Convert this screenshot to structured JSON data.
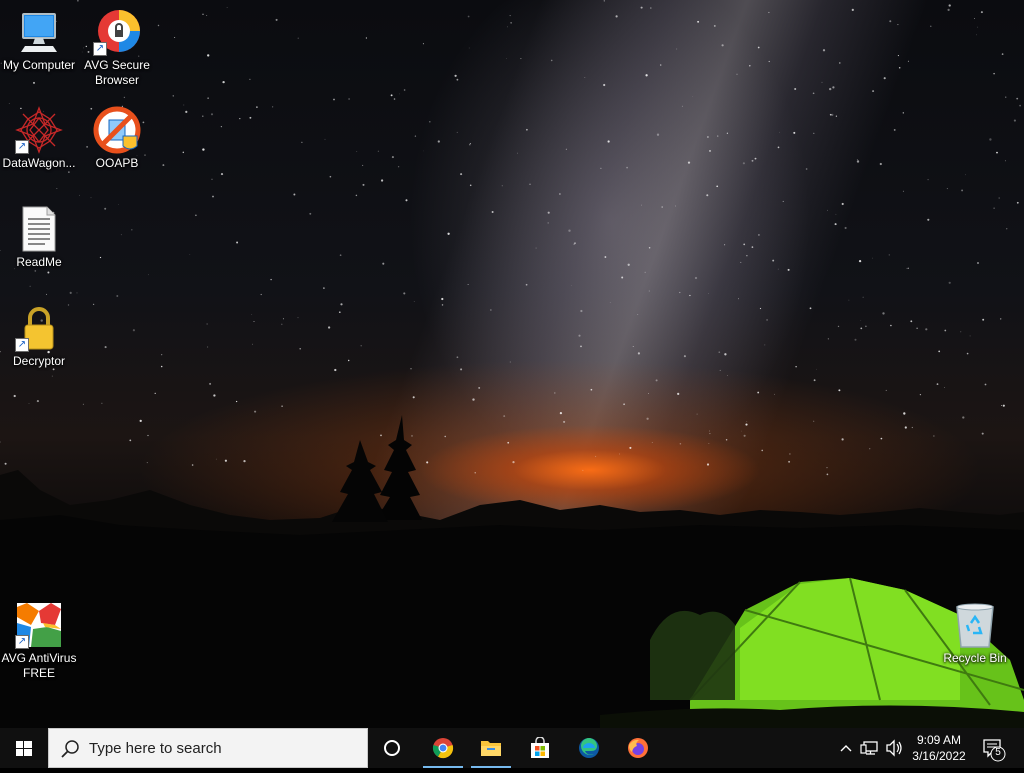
{
  "desktop_icons": [
    {
      "id": "my-computer",
      "label": "My Computer",
      "icon": "monitor-icon"
    },
    {
      "id": "avg-secure-browser",
      "label": "AVG Secure Browser",
      "icon": "avg-browser-icon"
    },
    {
      "id": "datawagon",
      "label": "DataWagon...",
      "icon": "datawagon-icon"
    },
    {
      "id": "ooapb",
      "label": "OOAPB",
      "icon": "ooapb-icon"
    },
    {
      "id": "readme",
      "label": "ReadMe",
      "icon": "text-document-icon"
    },
    {
      "id": "decryptor",
      "label": "Decryptor",
      "icon": "padlock-icon"
    },
    {
      "id": "avg-antivirus",
      "label": "AVG AntiVirus FREE",
      "icon": "avg-antivirus-icon"
    },
    {
      "id": "recycle-bin",
      "label": "Recycle Bin",
      "icon": "recycle-bin-icon"
    }
  ],
  "taskbar": {
    "start_icon": "windows-logo-icon",
    "search_placeholder": "Type here to search",
    "pinned": [
      {
        "name": "cortana",
        "icon": "cortana-circle-icon"
      },
      {
        "name": "chrome",
        "icon": "chrome-icon"
      },
      {
        "name": "file-explorer",
        "icon": "folder-icon"
      },
      {
        "name": "microsoft-store",
        "icon": "store-bag-icon"
      },
      {
        "name": "edge",
        "icon": "edge-icon"
      },
      {
        "name": "firefox",
        "icon": "firefox-icon"
      }
    ],
    "tray": {
      "icons": [
        "chevron-up-icon",
        "network-icon",
        "speaker-icon"
      ],
      "time": "9:09 AM",
      "date": "3/16/2022",
      "notification_count": "5"
    }
  }
}
